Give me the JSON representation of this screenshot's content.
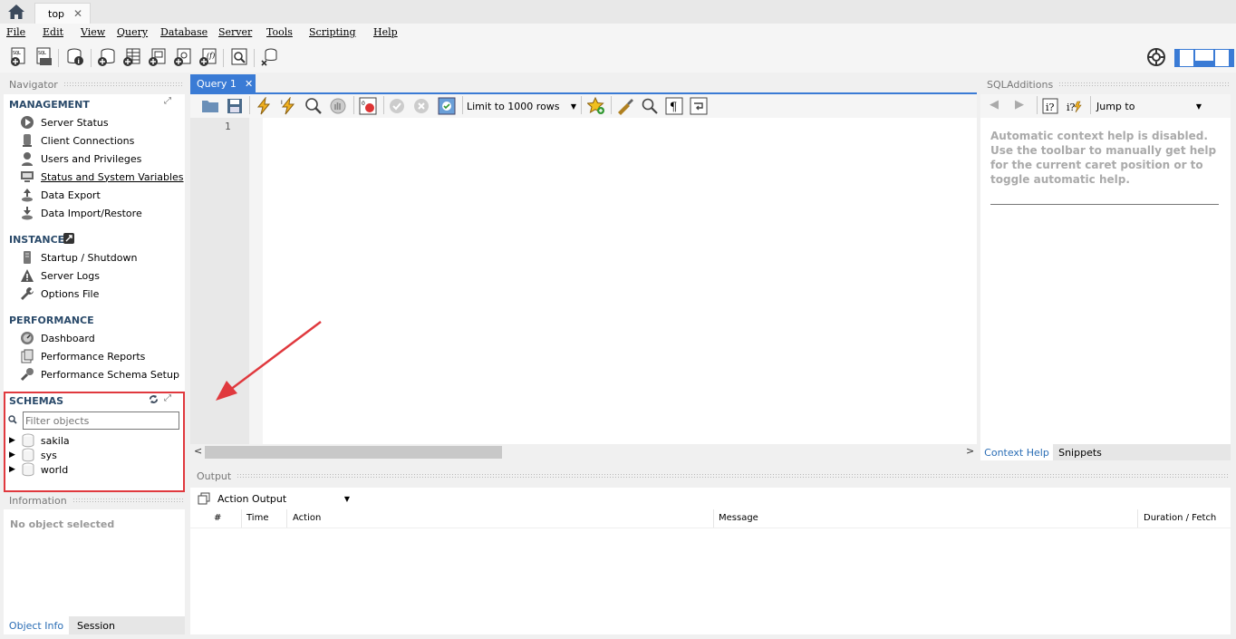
{
  "window": {
    "tab_label": "top",
    "tab_close": "✕"
  },
  "menu": {
    "items": [
      "File",
      "Edit",
      "View",
      "Query",
      "Database",
      "Server",
      "Tools",
      "Scripting",
      "Help"
    ]
  },
  "navigator": {
    "header": "Navigator",
    "management": {
      "title": "MANAGEMENT",
      "items": [
        "Server Status",
        "Client Connections",
        "Users and Privileges",
        "Status and System Variables",
        "Data Export",
        "Data Import/Restore"
      ]
    },
    "instance": {
      "title": "INSTANCE",
      "items": [
        "Startup / Shutdown",
        "Server Logs",
        "Options File"
      ]
    },
    "performance": {
      "title": "PERFORMANCE",
      "items": [
        "Dashboard",
        "Performance Reports",
        "Performance Schema Setup"
      ]
    },
    "schemas": {
      "title": "SCHEMAS",
      "filter_placeholder": "Filter objects",
      "items": [
        "sakila",
        "sys",
        "world"
      ]
    }
  },
  "information": {
    "header": "Information",
    "empty_text": "No object selected",
    "tabs": [
      "Object Info",
      "Session"
    ]
  },
  "editor": {
    "tab_label": "Query 1",
    "tab_close": "✕",
    "limit_label": "Limit to 1000 rows",
    "line_number": "1"
  },
  "sql_additions": {
    "header": "SQLAdditions",
    "jump_to": "Jump to",
    "help_text": "Automatic context help is disabled. Use the toolbar to manually get help for the current caret position or to toggle automatic help.",
    "tabs": [
      "Context Help",
      "Snippets"
    ]
  },
  "output": {
    "header": "Output",
    "select_label": "Action Output",
    "columns": [
      "#",
      "Time",
      "Action",
      "Message",
      "Duration / Fetch"
    ]
  },
  "colors": {
    "accent": "#3a7bd5",
    "highlight_box": "#e0393e",
    "section_title": "#2a4a6a"
  }
}
